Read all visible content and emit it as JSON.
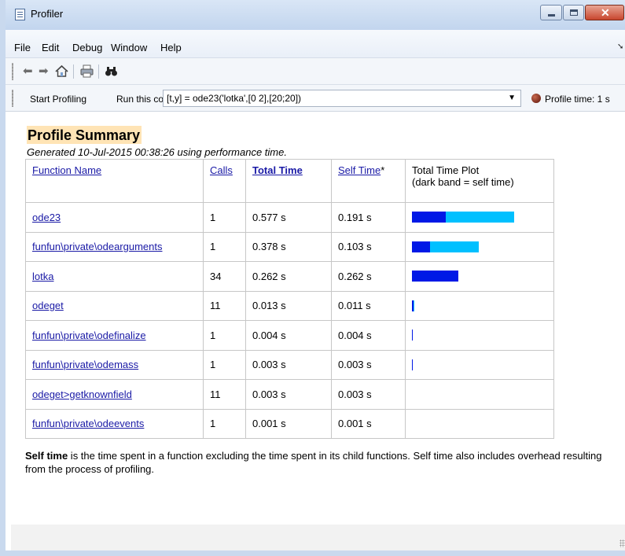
{
  "window": {
    "title": "Profiler"
  },
  "menu": [
    "File",
    "Edit",
    "Debug",
    "Window",
    "Help"
  ],
  "toolbar": {
    "icons": [
      "back-arrow-icon",
      "forward-arrow-icon",
      "home-icon",
      "print-icon",
      "find-binoculars-icon"
    ]
  },
  "runbar": {
    "start_label": "Start Profiling",
    "run_label": "Run this code:",
    "code": "[t,y] = ode23('lotka',[0 2],[20;20])",
    "profile_time": "Profile time: 1 s"
  },
  "summary": {
    "title": "Profile Summary",
    "generated": "Generated 10-Jul-2015 00:38:26 using performance time.",
    "columns": {
      "function_name": "Function Name",
      "calls": "Calls",
      "total_time": "Total Time",
      "self_time": "Self Time",
      "self_time_mark": "*",
      "plot_line1": "Total Time Plot",
      "plot_line2": "(dark band = self time)"
    },
    "rows": [
      {
        "name": "ode23",
        "calls": "1",
        "total": "0.577 s",
        "self": "0.191 s",
        "total_s": 0.577,
        "self_s": 0.191
      },
      {
        "name": "funfun\\private\\odearguments",
        "calls": "1",
        "total": "0.378 s",
        "self": "0.103 s",
        "total_s": 0.378,
        "self_s": 0.103
      },
      {
        "name": "lotka",
        "calls": "34",
        "total": "0.262 s",
        "self": "0.262 s",
        "total_s": 0.262,
        "self_s": 0.262
      },
      {
        "name": "odeget",
        "calls": "11",
        "total": "0.013 s",
        "self": "0.011 s",
        "total_s": 0.013,
        "self_s": 0.011
      },
      {
        "name": "funfun\\private\\odefinalize",
        "calls": "1",
        "total": "0.004 s",
        "self": "0.004 s",
        "total_s": 0.004,
        "self_s": 0.004
      },
      {
        "name": "funfun\\private\\odemass",
        "calls": "1",
        "total": "0.003 s",
        "self": "0.003 s",
        "total_s": 0.003,
        "self_s": 0.003
      },
      {
        "name": "odeget>getknownfield",
        "calls": "11",
        "total": "0.003 s",
        "self": "0.003 s",
        "total_s": 0.003,
        "self_s": 0.003
      },
      {
        "name": "funfun\\private\\odeevents",
        "calls": "1",
        "total": "0.001 s",
        "self": "0.001 s",
        "total_s": 0.001,
        "self_s": 0.001
      }
    ],
    "footnote_bold": "Self time",
    "footnote_text": " is the time spent in a function excluding the time spent in its child functions. Self time also includes overhead resulting from the process of profiling."
  },
  "colors": {
    "self_bar": "#0019e6",
    "total_bar": "#00c0ff",
    "highlight": "#ffe4b5",
    "link": "#1a1aa6"
  }
}
